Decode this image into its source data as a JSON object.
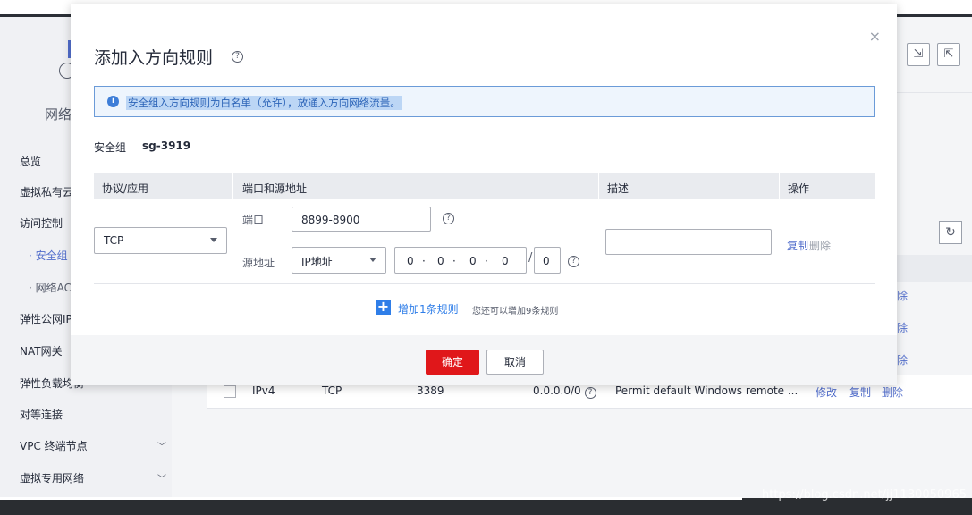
{
  "background": {
    "sidebar": {
      "title": "网络",
      "items": [
        {
          "label": "总览"
        },
        {
          "label": "虚拟私有云"
        },
        {
          "label": "访问控制"
        },
        {
          "label": "安全组"
        },
        {
          "label": "网络ACL"
        },
        {
          "label": "弹性公网IP"
        },
        {
          "label": "NAT网关"
        },
        {
          "label": "弹性负载均衡"
        },
        {
          "label": "对等连接"
        },
        {
          "label": "VPC 终端节点"
        },
        {
          "label": "虚拟专用网络"
        }
      ]
    },
    "table_row": {
      "type": "IPv4",
      "protocol": "TCP",
      "port": "3389",
      "source": "0.0.0.0/0",
      "description": "Permit default Windows remote ...",
      "actions": [
        "修改",
        "复制",
        "删除"
      ]
    },
    "partial_action": "除",
    "watermark": "https://blog.csdn.net/jj1130050965"
  },
  "modal": {
    "title": "添加入方向规则",
    "close": "×",
    "notice": "安全组入方向规则为白名单（允许），放通入方向网络流量。",
    "security_group_label": "安全组",
    "security_group_value": "sg-3919",
    "columns": [
      "协议/应用",
      "端口和源地址",
      "描述",
      "操作"
    ],
    "rule": {
      "protocol": "TCP",
      "port_label": "端口",
      "port_value": "8899-8900",
      "source_label": "源地址",
      "source_type": "IP地址",
      "ip": [
        "0",
        "0",
        "0",
        "0"
      ],
      "mask": "0",
      "description": "",
      "copy": "复制",
      "delete": "删除"
    },
    "add_rule": "增加1条规则",
    "add_hint": "您还可以增加9条规则",
    "ok": "确定",
    "cancel": "取消"
  }
}
